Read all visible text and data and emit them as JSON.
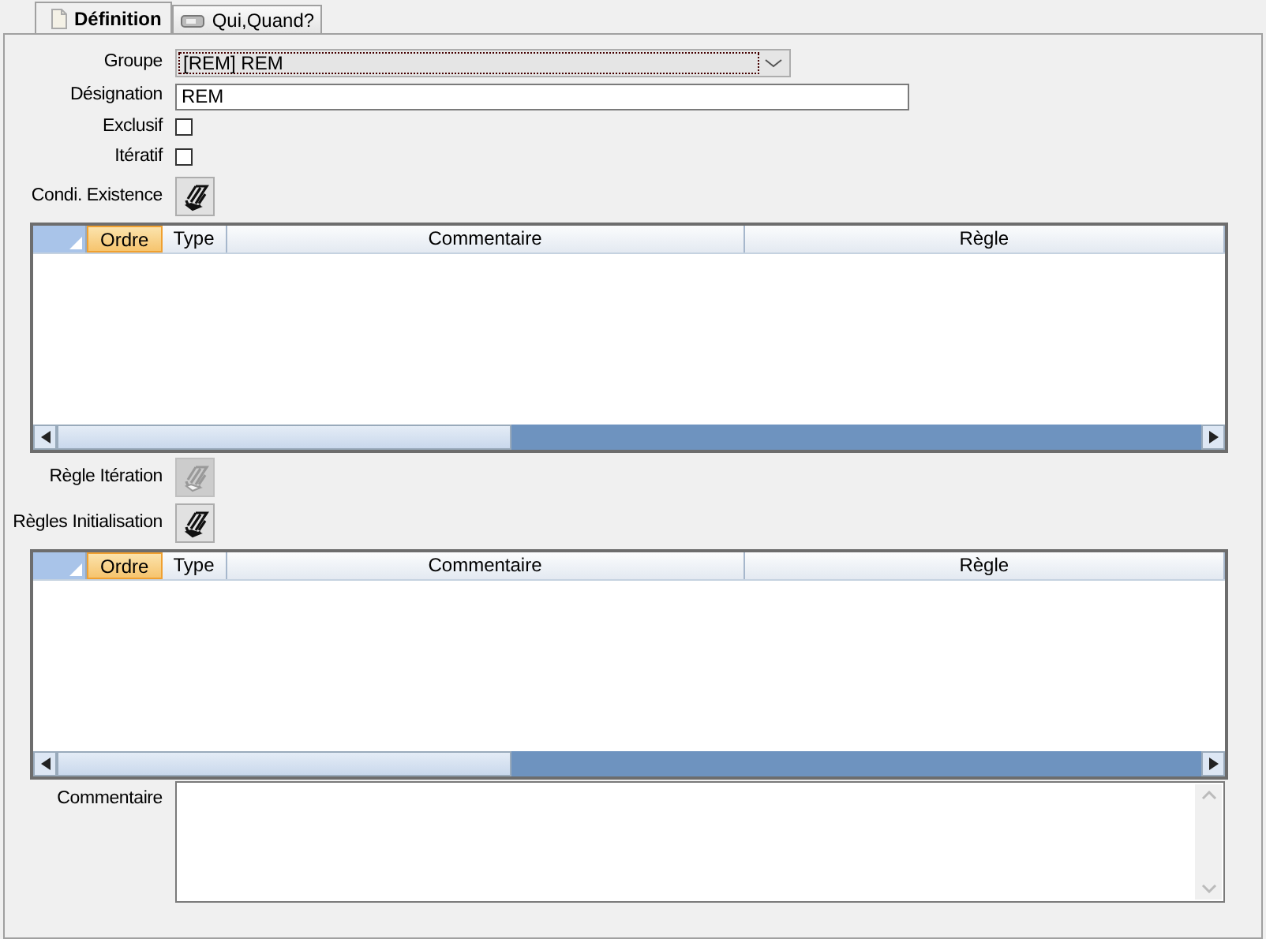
{
  "tabs": [
    {
      "label": "Définition",
      "selected": true
    },
    {
      "label": "Qui,Quand?",
      "selected": false
    }
  ],
  "form": [
    {
      "kind": "select",
      "label": "Groupe",
      "value": "[REM] REM"
    },
    {
      "kind": "text",
      "label": "Désignation",
      "value": "REM"
    },
    {
      "kind": "checkbox",
      "label": "Exclusif",
      "checked": false
    },
    {
      "kind": "checkbox",
      "label": "Itératif",
      "checked": false
    },
    {
      "kind": "rule_button",
      "label": "Condi. Existence",
      "disabled": false
    },
    {
      "kind": "grid",
      "columns": [
        {
          "label": "Ordre",
          "selected": true
        },
        {
          "label": "Type",
          "selected": false
        },
        {
          "label": "Commentaire",
          "selected": false
        },
        {
          "label": "Règle",
          "selected": false
        }
      ]
    },
    {
      "kind": "rule_button",
      "label": "Règle Itération",
      "disabled": true
    },
    {
      "kind": "rule_button",
      "label": "Règles Initialisation",
      "disabled": false
    },
    {
      "kind": "grid",
      "columns": [
        {
          "label": "Ordre",
          "selected": true
        },
        {
          "label": "Type",
          "selected": false
        },
        {
          "label": "Commentaire",
          "selected": false
        },
        {
          "label": "Règle",
          "selected": false
        }
      ]
    },
    {
      "kind": "textarea",
      "label": "Commentaire"
    }
  ]
}
